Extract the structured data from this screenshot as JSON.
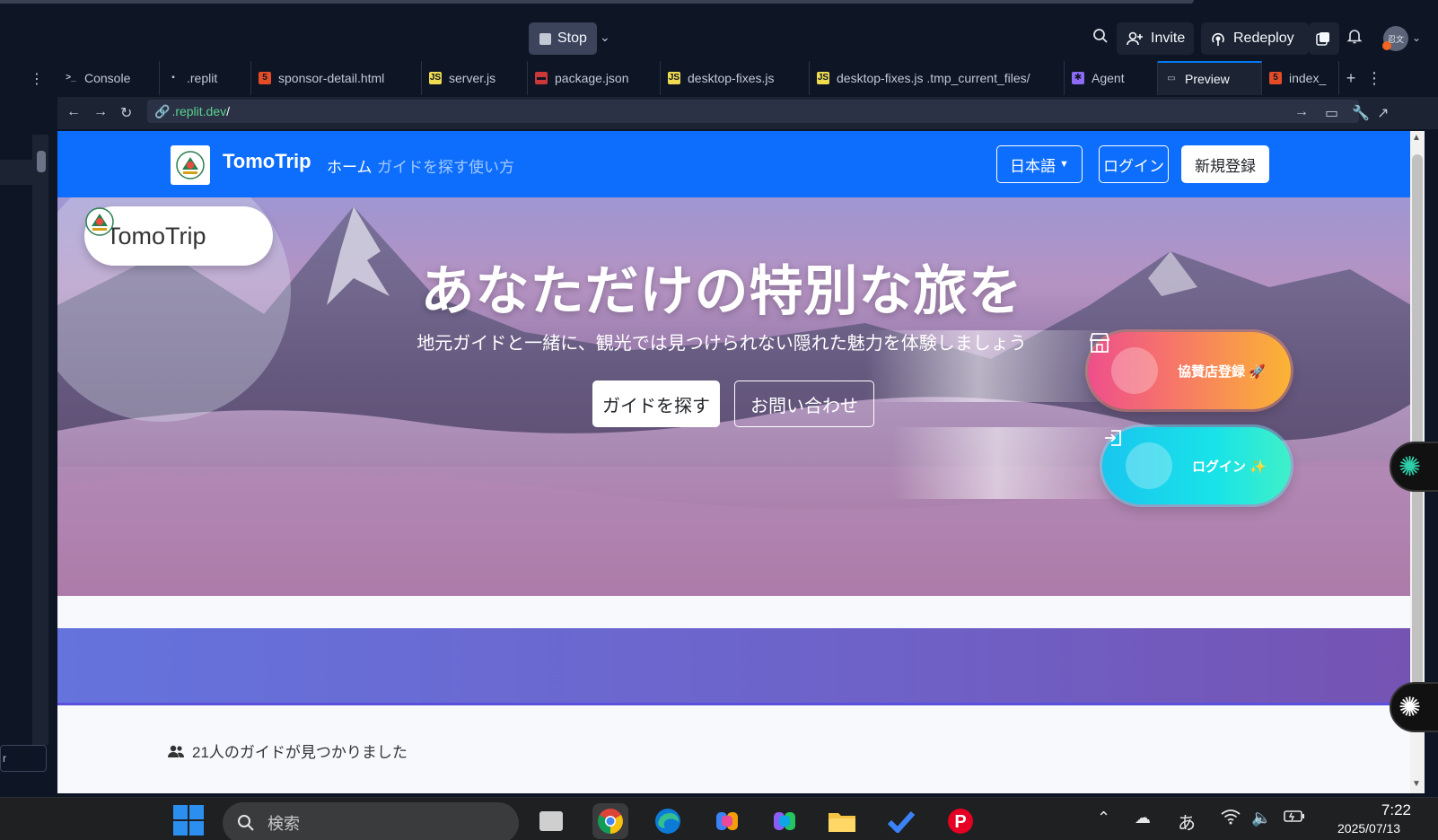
{
  "topbar": {
    "stop_label": "Stop",
    "invite_label": "Invite",
    "redeploy_label": "Redeploy",
    "avatar_text": "忍文"
  },
  "tabs": [
    {
      "label": "Console",
      "icon": "terminal-icon",
      "color": "#c2c8d4"
    },
    {
      "label": ".replit",
      "icon": "config-icon",
      "color": "#c2c8d4"
    },
    {
      "label": "sponsor-detail.html",
      "icon": "html-icon",
      "color": "#e34c26"
    },
    {
      "label": "server.js",
      "icon": "js-icon",
      "color": "#f0db4f"
    },
    {
      "label": "package.json",
      "icon": "npm-icon",
      "color": "#cb3837"
    },
    {
      "label": "desktop-fixes.js",
      "icon": "js-icon",
      "color": "#f0db4f"
    },
    {
      "label": "desktop-fixes.js .tmp_current_files/",
      "icon": "js-icon",
      "color": "#f0db4f"
    },
    {
      "label": "Agent",
      "icon": "agent-icon",
      "color": "#8c6cf5"
    },
    {
      "label": "Preview",
      "icon": "monitor-icon",
      "color": "#c2c8d4",
      "active": true
    },
    {
      "label": "index_",
      "icon": "html-icon",
      "color": "#e34c26"
    }
  ],
  "address": {
    "url_domain": ".replit.dev",
    "url_path": "/"
  },
  "leftpane": {
    "field_text": "r"
  },
  "site": {
    "brand": "TomoTrip",
    "nav_home": "ホーム",
    "nav_find": "ガイドを探す",
    "nav_howto": "使い方",
    "lang_button": "日本語",
    "login_button": "ログイン",
    "signup_button": "新規登録",
    "hero_pill": "TomoTrip",
    "hero_title": "あなただけの特別な旅を",
    "hero_subtitle": "地元ガイドと一緒に、観光では見つけられない隠れた魅力を体験しましょう",
    "hero_find_button": "ガイドを探す",
    "hero_contact_button": "お問い合わせ",
    "float_sponsor": "協賛店登録 🚀",
    "float_login": "ログイン ✨",
    "guides_found": "21人のガイドが見つかりました"
  },
  "taskbar": {
    "search_placeholder": "検索",
    "ime": "あ",
    "time": "7:22",
    "date": "2025/07/13"
  },
  "colors": {
    "replit_bg": "#0e1525",
    "navbar_blue": "#0d6efd",
    "accent_blue": "#0079f2"
  }
}
